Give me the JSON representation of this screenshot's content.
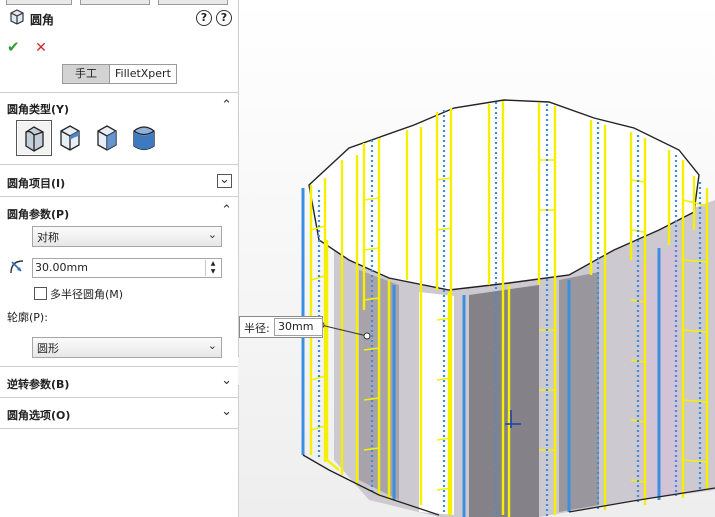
{
  "feature": {
    "title": "圆角"
  },
  "help": {
    "q1": "?",
    "q2": "?"
  },
  "actions": {
    "ok": "✔",
    "cancel": "✕"
  },
  "mode": {
    "manual": "手工",
    "expert": "FilletXpert"
  },
  "sections": {
    "fillet_type": {
      "label": "圆角类型(Y)",
      "chevron": "⌃"
    },
    "items": {
      "label": "圆角项目(I)",
      "chevron": "⌄"
    },
    "params": {
      "label": "圆角参数(P)",
      "chevron": "⌃"
    },
    "reverse": {
      "label": "逆转参数(B)",
      "chevron": "⌄"
    },
    "options": {
      "label": "圆角选项(O)",
      "chevron": "⌄"
    }
  },
  "params": {
    "symmetry": "对称",
    "radius": "30.00mm",
    "multi_radius": "多半径圆角(M)",
    "profile_label": "轮廓(P):",
    "profile": "圆形",
    "dropdown_arrow": "⌄"
  },
  "callout": {
    "key": "半径:",
    "value": "30mm"
  },
  "icons": {
    "feature": "fillet-feature-icon",
    "radius": "radius-icon",
    "type_icons": [
      "constant-size-fillet-icon",
      "variable-size-fillet-icon",
      "face-fillet-icon",
      "full-round-fillet-icon"
    ]
  },
  "colors": {
    "highlight": "#ffff00",
    "edge_blue": "#3a8fe0",
    "body_gray": "#8e8a8f"
  }
}
